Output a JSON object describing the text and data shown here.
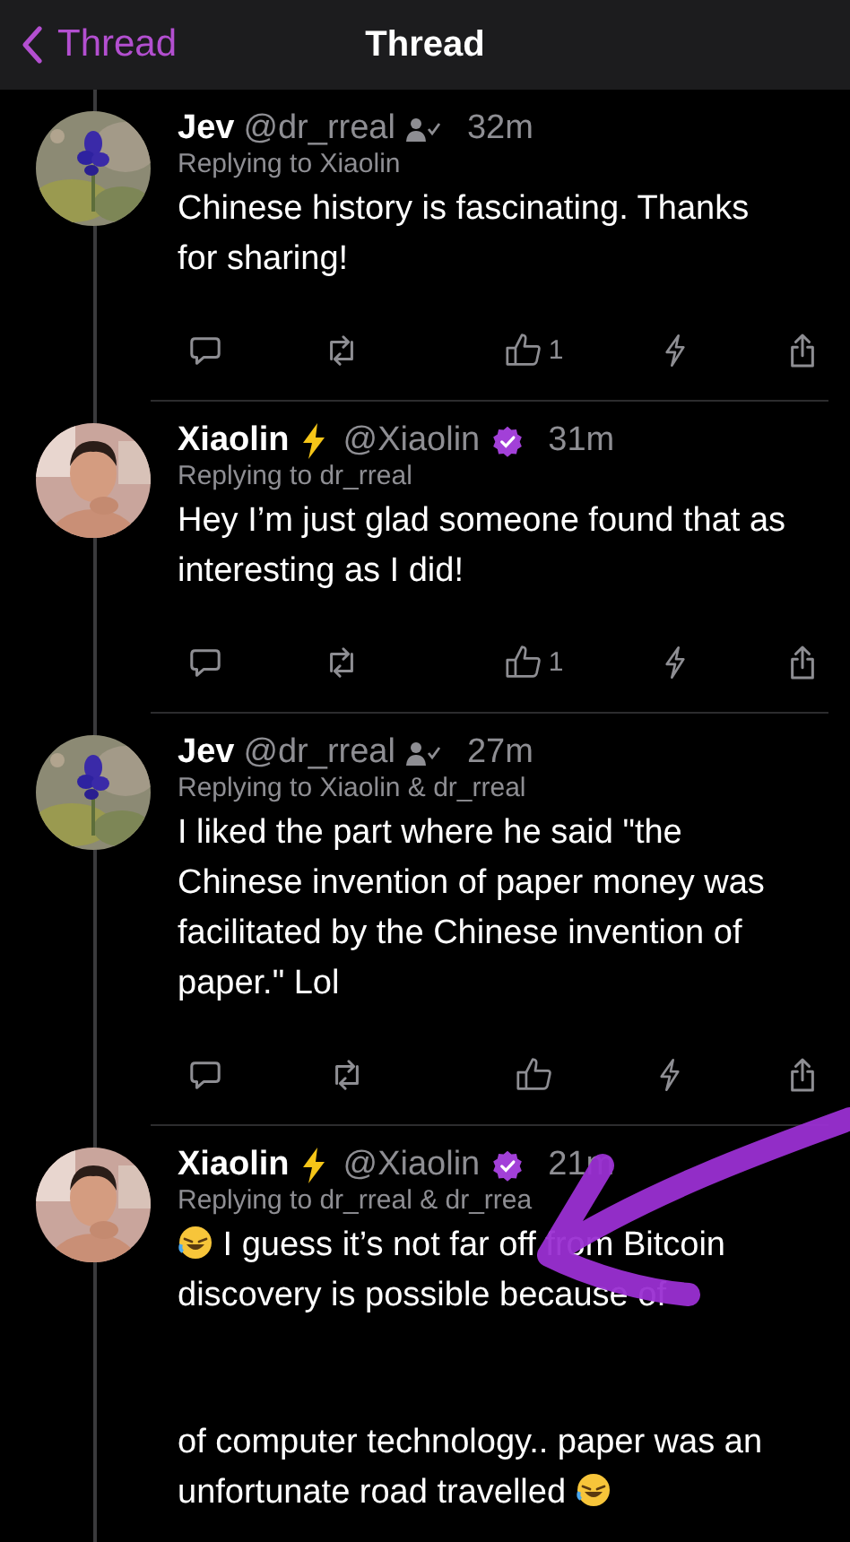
{
  "header": {
    "back_label": "Thread",
    "title": "Thread"
  },
  "posts": [
    {
      "avatar": {
        "kind": "picture"
      },
      "name": "Jev",
      "lightning": false,
      "handle": "@dr_rreal",
      "verified": false,
      "follows_you": true,
      "time": "32m",
      "replying_to": "Replying to Xiaolin",
      "body": [
        {
          "text": "Chinese history is fascinating. Thanks for sharing!",
          "laugh_before": false,
          "laugh_after": false
        }
      ],
      "actions_shown": true,
      "like_count": "1"
    },
    {
      "avatar": {
        "kind": "picture"
      },
      "name": "Xiaolin",
      "lightning": true,
      "handle": "@Xiaolin",
      "verified": true,
      "follows_you": false,
      "time": "31m",
      "replying_to": "Replying to dr_rreal",
      "body": [
        {
          "text": "Hey I’m just glad someone found that as interesting as I did!",
          "laugh_before": false,
          "laugh_after": false
        }
      ],
      "actions_shown": true,
      "like_count": "1"
    },
    {
      "avatar": {
        "kind": "picture"
      },
      "name": "Jev",
      "lightning": false,
      "handle": "@dr_rreal",
      "verified": false,
      "follows_you": true,
      "time": "27m",
      "replying_to": "Replying to Xiaolin & dr_rreal",
      "body": [
        {
          "text": "I liked the part where he said \"the Chinese invention of paper money was facilitated by the Chinese invention of paper.\" Lol",
          "laugh_before": false,
          "laugh_after": false
        }
      ],
      "actions_shown": true
    },
    {
      "avatar": {
        "kind": "picture"
      },
      "name": "Xiaolin",
      "lightning": true,
      "handle": "@Xiaolin",
      "verified": true,
      "follows_you": false,
      "time": "21m",
      "replying_to": "Replying to dr_rreal & dr_rrea",
      "body": [
        {
          "text": "I guess it’s not far off from Bitcoin discovery is possible because of",
          "laugh_before": true,
          "laugh_after": false
        },
        {
          "text": "of computer technology.. paper was an unfortunate road travelled",
          "laugh_before": false,
          "laugh_after": true
        }
      ],
      "actions_shown": false
    }
  ]
}
